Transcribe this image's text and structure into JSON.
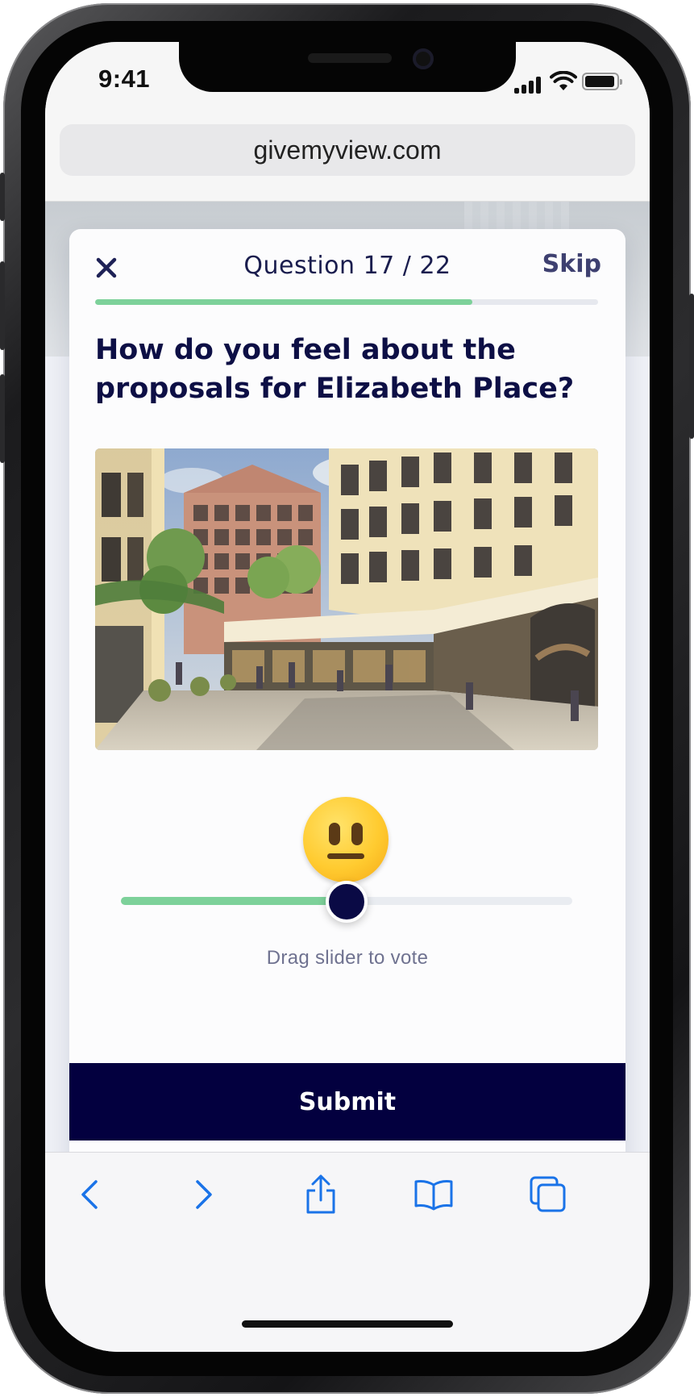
{
  "status_bar": {
    "time": "9:41"
  },
  "browser": {
    "url": "givemyview.com"
  },
  "survey": {
    "question_counter": "Question 17 / 22",
    "skip_label": "Skip",
    "progress": 0.75,
    "question_title": "How do you feel about the proposals for Elizabeth Place?",
    "illustration_label": "Watercolour rendering of Elizabeth Place street scene",
    "slider_value": 0.5,
    "slider_hint": "Drag slider to vote",
    "submit_label": "Submit"
  },
  "icons": {
    "close": "close-icon",
    "back": "back-arrow-icon",
    "forward": "forward-arrow-icon",
    "share": "share-icon",
    "bookmarks": "bookmarks-icon",
    "tabs": "tabs-icon",
    "mood": "neutral-face-icon"
  },
  "colors": {
    "accent_green": "#7dd19a",
    "navy": "#03003f",
    "ios_blue": "#1a73e8"
  }
}
